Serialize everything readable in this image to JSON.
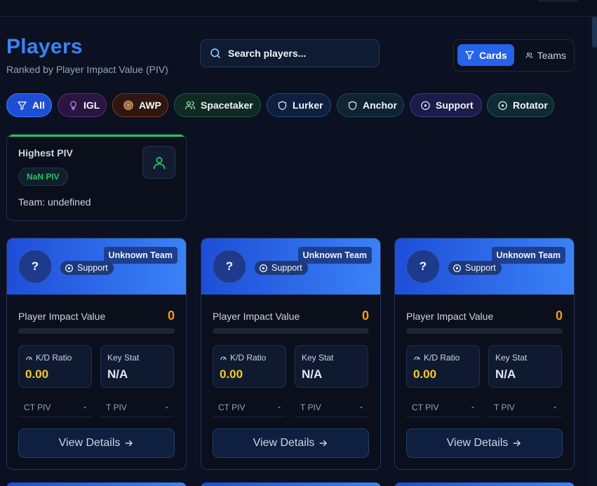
{
  "header": {
    "title": "Players",
    "subtitle": "Ranked by Player Impact Value (PIV)"
  },
  "search": {
    "placeholder": "Search players..."
  },
  "view_toggle": {
    "cards_label": "Cards",
    "teams_label": "Teams",
    "active": "Cards"
  },
  "filters": [
    {
      "label": "All",
      "icon": "filter-icon",
      "active": true
    },
    {
      "label": "IGL",
      "icon": "lightbulb-icon"
    },
    {
      "label": "AWP",
      "icon": "target-icon"
    },
    {
      "label": "Spacetaker",
      "icon": "users-icon"
    },
    {
      "label": "Lurker",
      "icon": "shield-icon"
    },
    {
      "label": "Anchor",
      "icon": "shield-icon"
    },
    {
      "label": "Support",
      "icon": "circle-dot-icon"
    },
    {
      "label": "Rotator",
      "icon": "circle-dot-icon"
    }
  ],
  "highlight": {
    "title": "Highest PIV",
    "badge": "NaN PIV",
    "team": "Team: undefined",
    "icon": "user-icon"
  },
  "cards": [
    {
      "avatar": "?",
      "team": "Unknown Team",
      "role": "Support",
      "piv_label": "Player Impact Value",
      "piv_value": "0",
      "piv_fraction": 0,
      "kd_label": "K/D Ratio",
      "kd_value": "0.00",
      "key_label": "Key Stat",
      "key_value": "N/A",
      "ct_label": "CT PIV",
      "ct_value": "-",
      "t_label": "T PIV",
      "t_value": "-",
      "button": "View Details"
    },
    {
      "avatar": "?",
      "team": "Unknown Team",
      "role": "Support",
      "piv_label": "Player Impact Value",
      "piv_value": "0",
      "piv_fraction": 0,
      "kd_label": "K/D Ratio",
      "kd_value": "0.00",
      "key_label": "Key Stat",
      "key_value": "N/A",
      "ct_label": "CT PIV",
      "ct_value": "-",
      "t_label": "T PIV",
      "t_value": "-",
      "button": "View Details"
    },
    {
      "avatar": "?",
      "team": "Unknown Team",
      "role": "Support",
      "piv_label": "Player Impact Value",
      "piv_value": "0",
      "piv_fraction": 0,
      "kd_label": "K/D Ratio",
      "kd_value": "0.00",
      "key_label": "Key Stat",
      "key_value": "N/A",
      "ct_label": "CT PIV",
      "ct_value": "-",
      "t_label": "T PIV",
      "t_value": "-",
      "button": "View Details"
    }
  ],
  "colors": {
    "accent": "#3b82f6",
    "piv": "#f59e0b",
    "kd": "#facc15",
    "success": "#22c55e",
    "background": "#0b1120"
  }
}
